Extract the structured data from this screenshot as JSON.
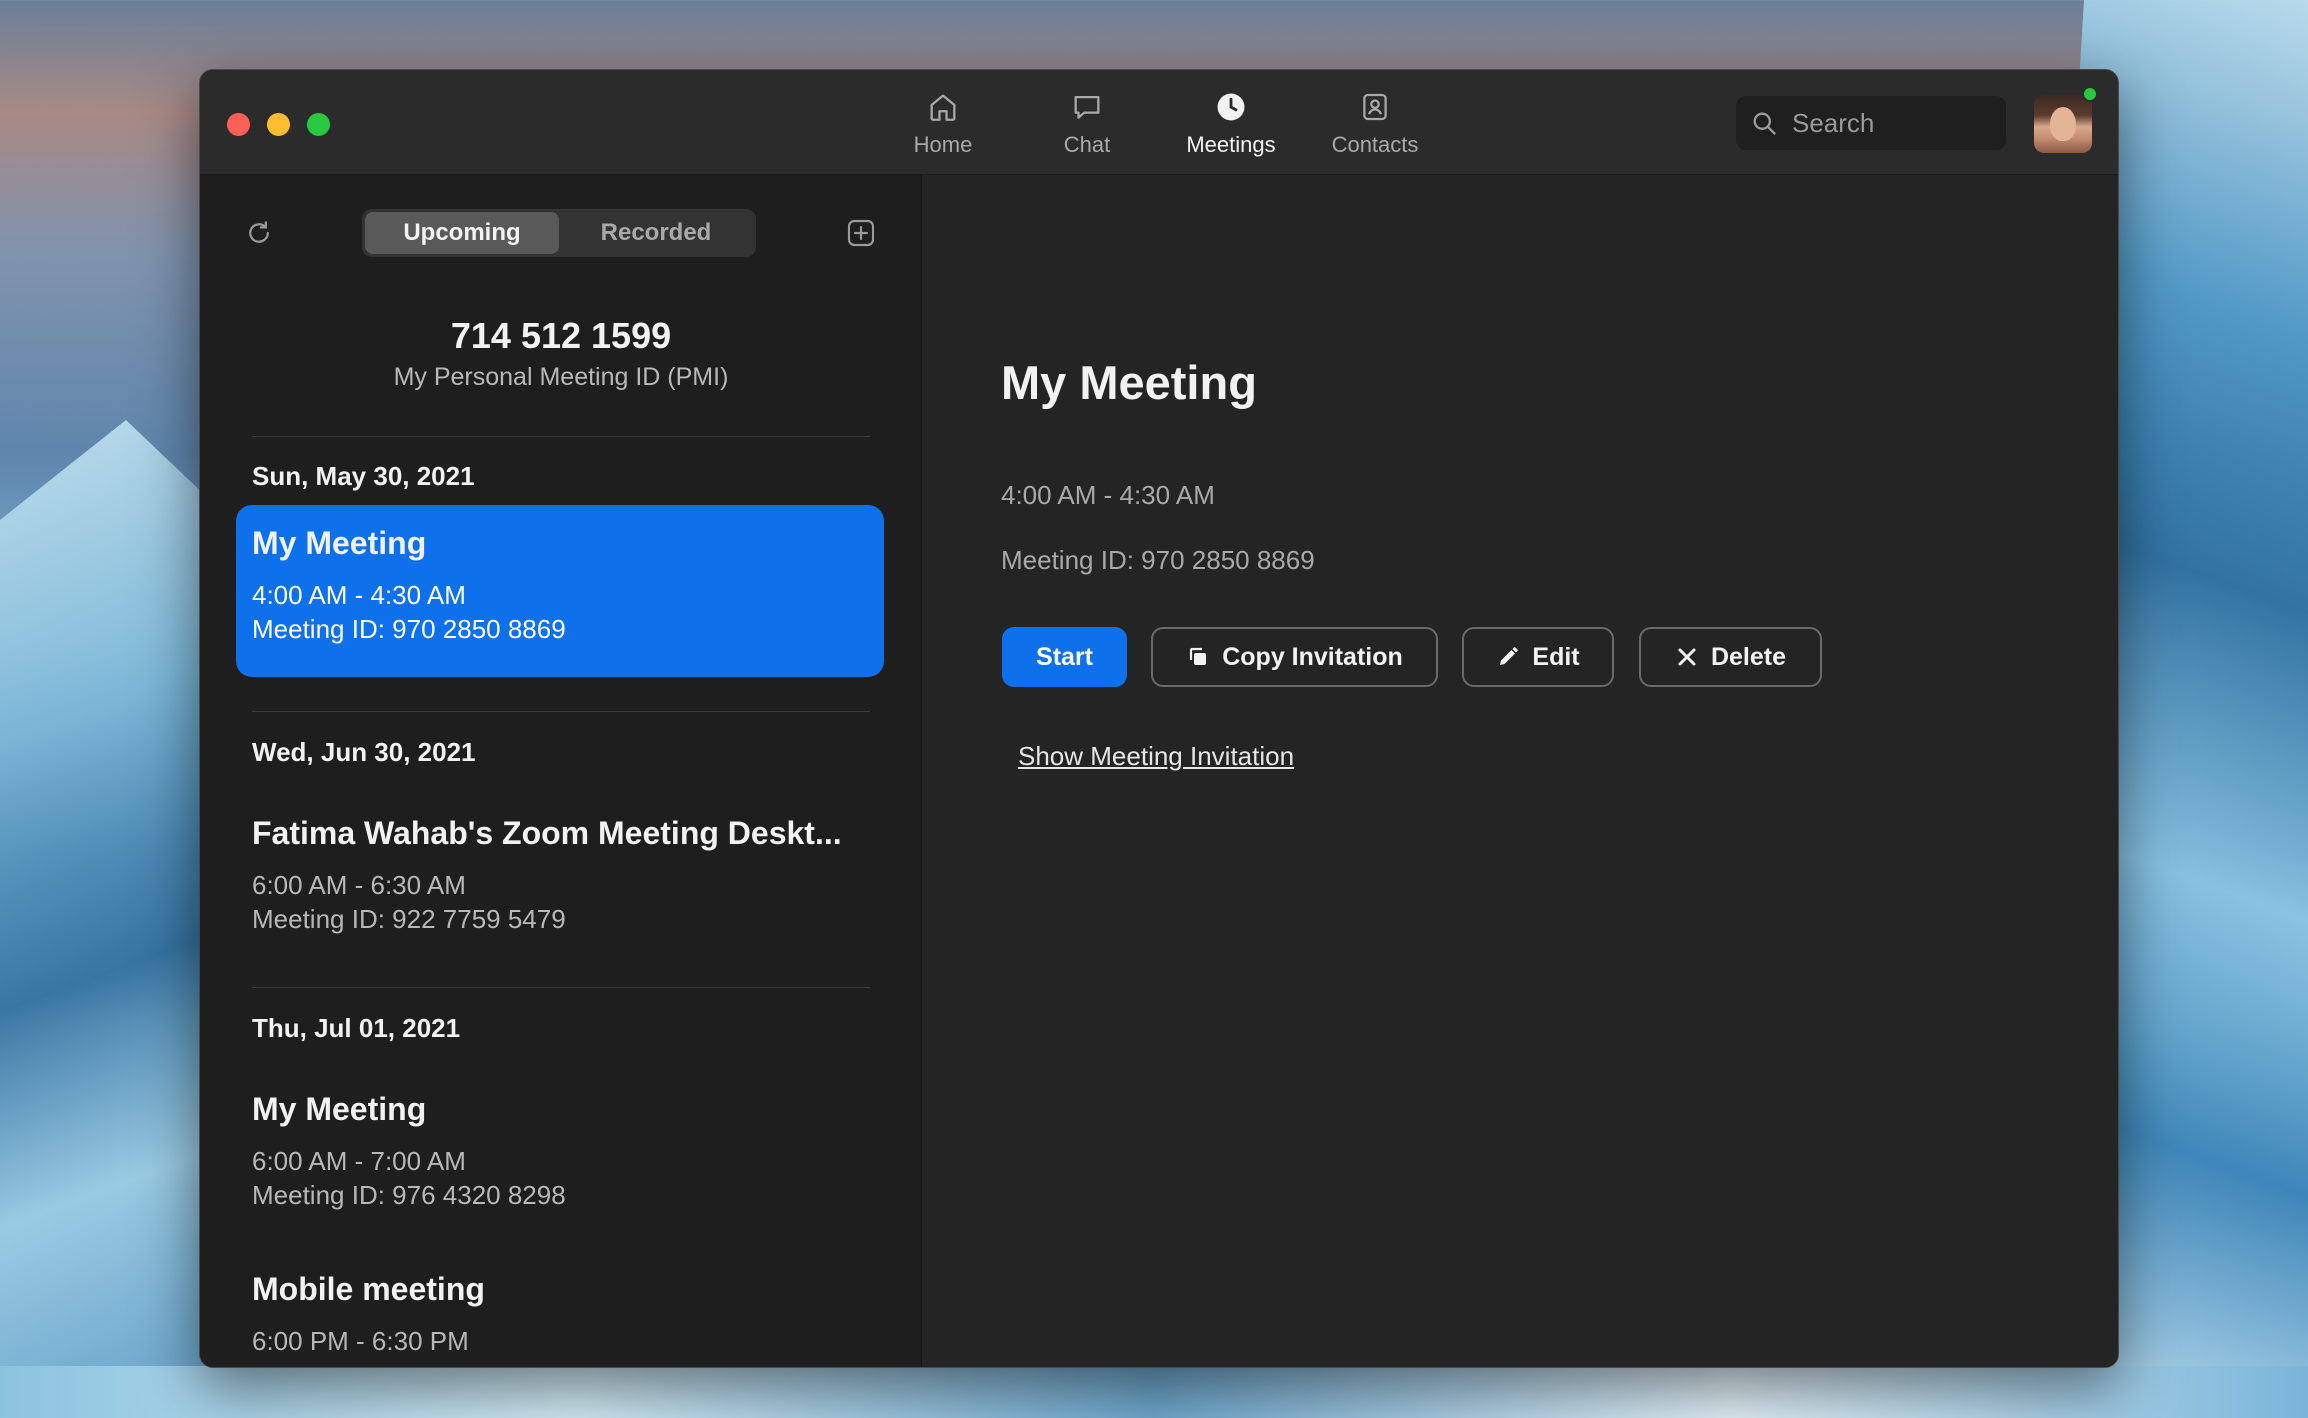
{
  "nav": {
    "tabs": [
      {
        "label": "Home",
        "icon": "home-icon"
      },
      {
        "label": "Chat",
        "icon": "chat-icon"
      },
      {
        "label": "Meetings",
        "icon": "clock-icon"
      },
      {
        "label": "Contacts",
        "icon": "contacts-icon"
      }
    ],
    "active": "Meetings"
  },
  "search": {
    "placeholder": "Search"
  },
  "sidebar": {
    "segments": [
      "Upcoming",
      "Recorded"
    ],
    "active_segment": "Upcoming",
    "pmi": {
      "number": "714 512 1599",
      "label": "My Personal Meeting ID (PMI)"
    },
    "groups": [
      {
        "date": "Sun, May 30, 2021",
        "meetings": [
          {
            "title": "My Meeting",
            "time": "4:00 AM - 4:30 AM",
            "meeting_id": "Meeting ID: 970 2850 8869",
            "selected": true
          }
        ]
      },
      {
        "date": "Wed, Jun 30, 2021",
        "meetings": [
          {
            "title": "Fatima Wahab's Zoom Meeting Deskt...",
            "time": "6:00 AM - 6:30 AM",
            "meeting_id": "Meeting ID: 922 7759 5479",
            "selected": false
          }
        ]
      },
      {
        "date": "Thu, Jul 01, 2021",
        "meetings": [
          {
            "title": "My Meeting",
            "time": "6:00 AM - 7:00 AM",
            "meeting_id": "Meeting ID: 976 4320 8298",
            "selected": false
          },
          {
            "title": "Mobile meeting",
            "time": "6:00 PM - 6:30 PM",
            "meeting_id": "",
            "selected": false
          }
        ]
      }
    ]
  },
  "detail": {
    "title": "My Meeting",
    "time": "4:00 AM - 4:30 AM",
    "meeting_id": "Meeting ID: 970 2850 8869",
    "buttons": {
      "start": "Start",
      "copy": "Copy Invitation",
      "edit": "Edit",
      "delete": "Delete"
    },
    "show_invitation": "Show Meeting Invitation"
  },
  "colors": {
    "accent": "#0e71eb",
    "window_bg": "#242424",
    "sidebar_bg": "#1e1e1e",
    "presence": "#28c840"
  }
}
